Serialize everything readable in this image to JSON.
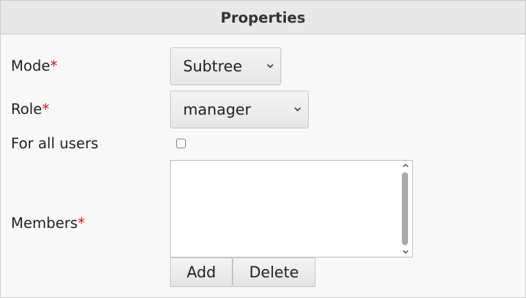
{
  "panel": {
    "title": "Properties"
  },
  "form": {
    "mode": {
      "label": "Mode",
      "required_marker": "*",
      "value": "Subtree"
    },
    "role": {
      "label": "Role",
      "required_marker": "*",
      "value": "manager"
    },
    "for_all_users": {
      "label": "For all users",
      "checked": false
    },
    "members": {
      "label": "Members",
      "required_marker": "*",
      "items": []
    }
  },
  "buttons": {
    "add_label": "Add",
    "delete_label": "Delete"
  },
  "icons": {
    "select_arrow": "chevron-down-icon",
    "scroll_up": "chevron-up-icon",
    "scroll_down": "chevron-down-icon"
  },
  "colors": {
    "required": "#d41414",
    "header_bg": "#e8e8e8",
    "panel_bg": "#f8f8f8"
  }
}
